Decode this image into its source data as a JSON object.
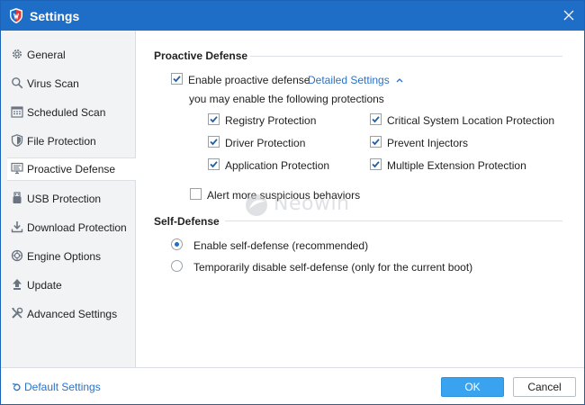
{
  "window": {
    "title": "Settings",
    "colors": {
      "titlebar": "#1e6ec8",
      "accent": "#39a3ef",
      "link": "#2a72c6",
      "sidebar": "#f2f3f5"
    }
  },
  "sidebar": {
    "items": [
      {
        "label": "General",
        "icon": "gear-icon"
      },
      {
        "label": "Virus Scan",
        "icon": "search-icon"
      },
      {
        "label": "Scheduled Scan",
        "icon": "calendar-icon"
      },
      {
        "label": "File Protection",
        "icon": "shield-icon"
      },
      {
        "label": "Proactive Defense",
        "icon": "monitor-icon",
        "active": true
      },
      {
        "label": "USB Protection",
        "icon": "usb-icon"
      },
      {
        "label": "Download Protection",
        "icon": "download-icon"
      },
      {
        "label": "Engine Options",
        "icon": "engine-icon"
      },
      {
        "label": "Update",
        "icon": "upload-arrow-icon"
      },
      {
        "label": "Advanced Settings",
        "icon": "tools-icon"
      }
    ]
  },
  "proactive": {
    "title": "Proactive Defense",
    "enable_label": "Enable proactive defense",
    "enable_checked": true,
    "detailed_link": "Detailed Settings",
    "hint": "you may enable the following protections",
    "protections": [
      {
        "label": "Registry Protection",
        "checked": true
      },
      {
        "label": "Critical System Location Protection",
        "checked": true
      },
      {
        "label": "Driver Protection",
        "checked": true
      },
      {
        "label": "Prevent Injectors",
        "checked": true
      },
      {
        "label": "Application Protection",
        "checked": true
      },
      {
        "label": "Multiple Extension Protection",
        "checked": true
      }
    ],
    "alert_label": "Alert more suspicious behaviors",
    "alert_checked": false
  },
  "self_defense": {
    "title": "Self-Defense",
    "options": [
      {
        "label": "Enable self-defense (recommended)",
        "selected": true
      },
      {
        "label": "Temporarily disable self-defense (only for the current boot)",
        "selected": false
      }
    ]
  },
  "watermark": {
    "text": "Neowin"
  },
  "footer": {
    "default_link": "Default Settings",
    "ok": "OK",
    "cancel": "Cancel"
  }
}
